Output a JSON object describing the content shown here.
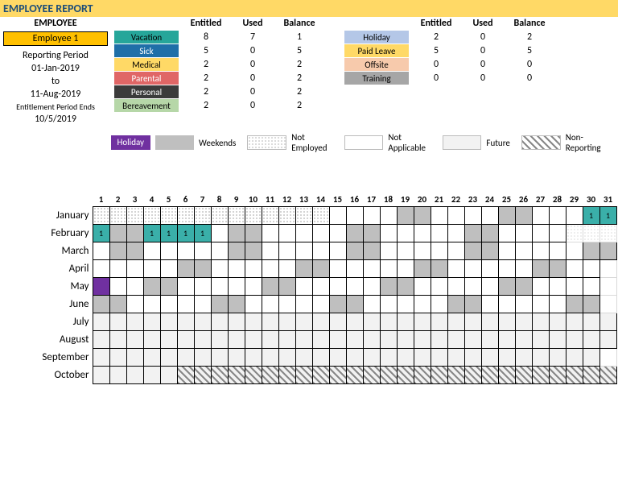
{
  "title": "EMPLOYEE REPORT",
  "employee_header": "EMPLOYEE",
  "employee_name": "Employee 1",
  "reporting_period_label": "Reporting Period",
  "reporting_start": "01-Jan-2019",
  "reporting_to": "to",
  "reporting_end": "11-Aug-2019",
  "entitlement_label": "Entitlement Period Ends",
  "entitlement_date": "10/5/2019",
  "cols": {
    "entitled": "Entitled",
    "used": "Used",
    "balance": "Balance"
  },
  "types1": [
    {
      "label": "Vacation",
      "cls": "vacation",
      "entitled": 8,
      "used": 7,
      "balance": 1
    },
    {
      "label": "Sick",
      "cls": "sick",
      "entitled": 5,
      "used": 0,
      "balance": 5
    },
    {
      "label": "Medical",
      "cls": "medical",
      "entitled": 2,
      "used": 0,
      "balance": 2
    },
    {
      "label": "Parental",
      "cls": "parental",
      "entitled": 2,
      "used": 0,
      "balance": 2
    },
    {
      "label": "Personal",
      "cls": "personal",
      "entitled": 2,
      "used": 0,
      "balance": 2
    },
    {
      "label": "Bereavement",
      "cls": "bereave",
      "entitled": 2,
      "used": 0,
      "balance": 2
    }
  ],
  "types2": [
    {
      "label": "Holiday",
      "cls": "holiday",
      "entitled": 2,
      "used": 0,
      "balance": 2
    },
    {
      "label": "Paid Leave",
      "cls": "paidleave",
      "entitled": 5,
      "used": 0,
      "balance": 5
    },
    {
      "label": "Offsite",
      "cls": "offsite",
      "entitled": 0,
      "used": 0,
      "balance": 0
    },
    {
      "label": "Training",
      "cls": "training",
      "entitled": 0,
      "used": 0,
      "balance": 0
    }
  ],
  "legend": {
    "holiday": "Holiday",
    "weekends": "Weekends",
    "not_employed": "Not Employed",
    "not_applicable": "Not Applicable",
    "future": "Future",
    "non_reporting": "Non-Reporting"
  },
  "months": [
    "January",
    "February",
    "March",
    "April",
    "May",
    "June",
    "July",
    "August",
    "September",
    "October"
  ],
  "chart_data": {
    "type": "heatmap",
    "title": "Employee 1 attendance Jan–Oct 2019",
    "x": [
      1,
      2,
      3,
      4,
      5,
      6,
      7,
      8,
      9,
      10,
      11,
      12,
      13,
      14,
      15,
      16,
      17,
      18,
      19,
      20,
      21,
      22,
      23,
      24,
      25,
      26,
      27,
      28,
      29,
      30,
      31
    ],
    "y": [
      "January",
      "February",
      "March",
      "April",
      "May",
      "June",
      "July",
      "August",
      "September",
      "October"
    ],
    "codes": {
      "d": "not-employed (dotted)",
      "": "working day (blank)",
      "w": "weekend",
      "h": "holiday",
      "v": "vacation (value 1)",
      "f": "future",
      "x": "non-reporting (hatched)",
      "n": "day does not exist",
      "b": "blank trailing cell"
    },
    "grid": [
      [
        "d",
        "d",
        "d",
        "d",
        "d",
        "d",
        "d",
        "d",
        "d",
        "d",
        "d",
        "d",
        "d",
        "d",
        "",
        "",
        "",
        "",
        "w",
        "w",
        "",
        "",
        "",
        "",
        "w",
        "w",
        "",
        "",
        "",
        "v",
        "v"
      ],
      [
        "v",
        "w",
        "w",
        "v",
        "v",
        "v",
        "v",
        "",
        "w",
        "w",
        "",
        "",
        "",
        "",
        "",
        "w",
        "w",
        "",
        "",
        "",
        "",
        "",
        "w",
        "w",
        "",
        "",
        "",
        "",
        "n",
        "n",
        "n"
      ],
      [
        "",
        "w",
        "w",
        "",
        "",
        "",
        "",
        "",
        "w",
        "w",
        "",
        "",
        "",
        "",
        "",
        "w",
        "w",
        "",
        "",
        "",
        "",
        "",
        "w",
        "w",
        "",
        "",
        "",
        "",
        "",
        "w",
        "w"
      ],
      [
        "",
        "",
        "",
        "",
        "",
        "w",
        "w",
        "",
        "",
        "",
        "",
        "",
        "w",
        "w",
        "",
        "",
        "",
        "",
        "",
        "w",
        "w",
        "",
        "",
        "",
        "",
        "",
        "w",
        "w",
        "",
        "",
        "b"
      ],
      [
        "h",
        "",
        "",
        "w",
        "w",
        "",
        "",
        "",
        "",
        "",
        "w",
        "w",
        "",
        "",
        "",
        "",
        "",
        "w",
        "w",
        "",
        "",
        "",
        "",
        "",
        "w",
        "w",
        "",
        "",
        "",
        "",
        "b"
      ],
      [
        "w",
        "w",
        "",
        "",
        "",
        "",
        "",
        "w",
        "w",
        "",
        "",
        "",
        "",
        "",
        "w",
        "w",
        "",
        "",
        "",
        "",
        "",
        "w",
        "w",
        "",
        "",
        "",
        "",
        "",
        "w",
        "w",
        "b"
      ],
      [
        "f",
        "f",
        "f",
        "f",
        "f",
        "f",
        "f",
        "f",
        "f",
        "f",
        "f",
        "f",
        "f",
        "f",
        "f",
        "f",
        "f",
        "f",
        "f",
        "f",
        "f",
        "f",
        "f",
        "f",
        "f",
        "f",
        "f",
        "f",
        "f",
        "f",
        "f"
      ],
      [
        "f",
        "f",
        "f",
        "f",
        "f",
        "f",
        "f",
        "f",
        "f",
        "f",
        "f",
        "f",
        "f",
        "f",
        "f",
        "f",
        "f",
        "f",
        "f",
        "f",
        "f",
        "f",
        "f",
        "f",
        "f",
        "f",
        "f",
        "f",
        "f",
        "f",
        "f"
      ],
      [
        "f",
        "f",
        "f",
        "f",
        "f",
        "f",
        "f",
        "f",
        "f",
        "f",
        "f",
        "f",
        "f",
        "f",
        "f",
        "f",
        "f",
        "f",
        "f",
        "f",
        "f",
        "f",
        "f",
        "f",
        "f",
        "f",
        "f",
        "f",
        "f",
        "f",
        "b"
      ],
      [
        "f",
        "f",
        "f",
        "f",
        "f",
        "x",
        "x",
        "x",
        "x",
        "x",
        "x",
        "x",
        "x",
        "x",
        "x",
        "x",
        "x",
        "x",
        "x",
        "x",
        "x",
        "x",
        "x",
        "x",
        "x",
        "x",
        "x",
        "x",
        "x",
        "x",
        "x"
      ]
    ]
  }
}
